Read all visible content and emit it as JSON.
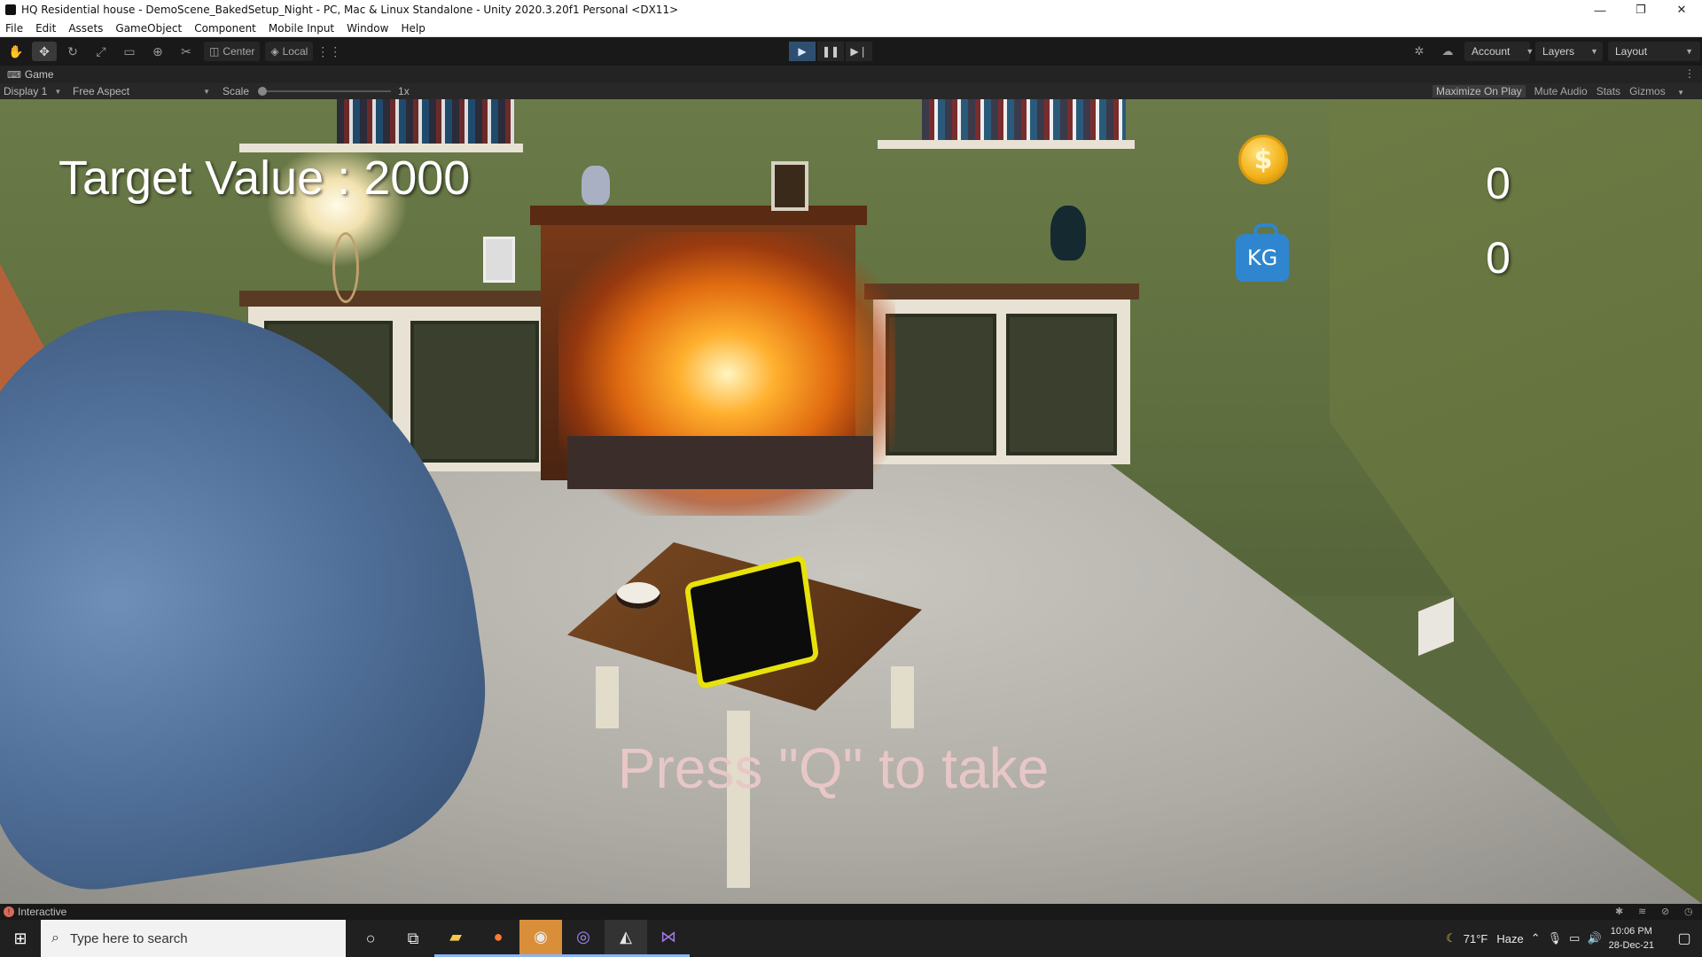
{
  "window": {
    "title": "HQ Residential house - DemoScene_BakedSetup_Night - PC, Mac & Linux Standalone - Unity 2020.3.20f1 Personal <DX11>",
    "minimize_glyph": "—",
    "restore_glyph": "❐",
    "close_glyph": "✕"
  },
  "menu": [
    "File",
    "Edit",
    "Assets",
    "GameObject",
    "Component",
    "Mobile Input",
    "Window",
    "Help"
  ],
  "toolbar": {
    "tools": [
      "hand-tool-icon",
      "move-tool-icon",
      "rotate-tool-icon",
      "scale-tool-icon",
      "rect-tool-icon",
      "transform-tool-icon",
      "custom-tool-icon"
    ],
    "pivot_label": "Center",
    "space_label": "Local",
    "account_label": "Account",
    "layers_label": "Layers",
    "layout_label": "Layout"
  },
  "game_tab": {
    "tab_label": "Game",
    "display_label": "Display 1",
    "aspect_label": "Free Aspect",
    "scale_label": "Scale",
    "scale_value": "1x",
    "maximize_label": "Maximize On Play",
    "mute_label": "Mute Audio",
    "stats_label": "Stats",
    "gizmos_label": "Gizmos"
  },
  "hud": {
    "target_text": "Target Value : 2000",
    "coin_symbol": "$",
    "money_value": "0",
    "kg_label": "KG",
    "weight_value": "0",
    "prompt_text": "Press \"Q\" to take"
  },
  "status": {
    "text": "Interactive"
  },
  "taskbar": {
    "search_placeholder": "Type here to search",
    "weather_temp": "71°F",
    "weather_desc": "Haze",
    "time": "10:06 PM",
    "date": "28-Dec-21"
  },
  "colors": {
    "highlight": "#e8e20c",
    "coin": "#f2b21a",
    "kg_icon": "#2f86cf",
    "prompt": "#e8c7c7"
  }
}
